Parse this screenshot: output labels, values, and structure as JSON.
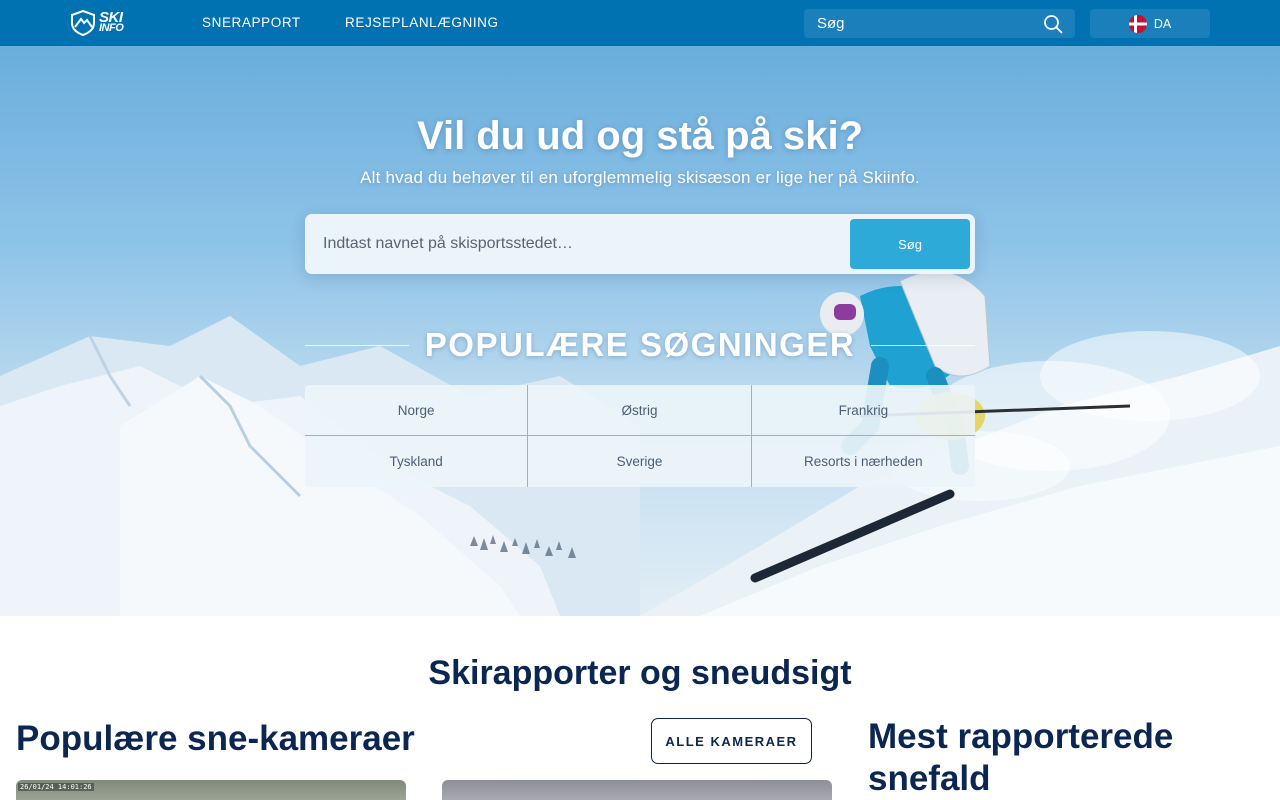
{
  "colors": {
    "nav_bg": "#0072b1",
    "nav_control_bg": "#1a7fba",
    "accent_button": "#2eaad9",
    "heading_navy": "#0b2650"
  },
  "header": {
    "logo": {
      "line1": "SKI",
      "line2": "INFO"
    },
    "nav": [
      {
        "label": "SNERAPPORT"
      },
      {
        "label": "REJSEPLANLÆGNING"
      }
    ],
    "search": {
      "placeholder": "Søg",
      "icon": "search-icon"
    },
    "language": {
      "label": "DA",
      "icon": "denmark-flag-icon"
    }
  },
  "hero": {
    "title": "Vil du ud og stå på ski?",
    "subtitle": "Alt hvad du behøver til en uforglemmelig skisæson er lige her på Skiinfo.",
    "search": {
      "placeholder": "Indtast navnet på skisportsstedet…",
      "button_label": "Søg"
    },
    "popular_title": "POPULÆRE SØGNINGER",
    "popular_items": [
      {
        "label": "Norge"
      },
      {
        "label": "Østrig"
      },
      {
        "label": "Frankrig"
      },
      {
        "label": "Tyskland"
      },
      {
        "label": "Sverige"
      },
      {
        "label": "Resorts i nærheden"
      }
    ]
  },
  "content": {
    "section_title": "Skirapporter og sneudsigt",
    "cams_title": "Populære sne-kameraer",
    "all_cams_label": "ALLE KAMERAER",
    "snowfall_title": "Mest rapporterede snefald",
    "cams": [
      {
        "timestamp": "26/01/24 14:01:26"
      },
      {
        "timestamp": ""
      }
    ]
  }
}
